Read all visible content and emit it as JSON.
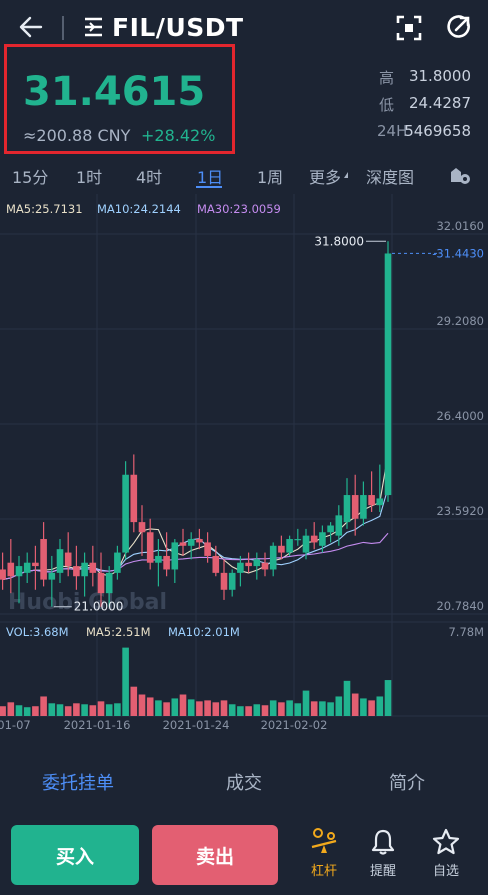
{
  "header": {
    "pair": "FIL/USDT"
  },
  "ticker": {
    "last_price": "31.4615",
    "cny": "≈200.88 CNY",
    "change": "+28.42%",
    "high_label": "高",
    "high": "31.8000",
    "low_label": "低",
    "low": "24.4287",
    "vol_label": "24H",
    "vol": "5469658"
  },
  "tabs": [
    "15分",
    "1时",
    "4时",
    "1日",
    "1周",
    "更多",
    "深度图"
  ],
  "active_tab": "1日",
  "chart_data": {
    "type": "candlestick",
    "interval": "1日",
    "ma_labels": {
      "ma5": "MA5:25.7131",
      "ma10": "MA10:24.2144",
      "ma30": "MA30:23.0059"
    },
    "price_axis": [
      "32.0160",
      "29.2080",
      "26.4000",
      "23.5920",
      "20.7840"
    ],
    "price_range": [
      20.784,
      32.016
    ],
    "current_price_label": "31.4430",
    "max_label": "31.8000",
    "min_label": "21.0000",
    "x_labels": [
      "01-07",
      "2021-01-16",
      "2021-01-24",
      "2021-02-02"
    ],
    "watermark": "Huobi Global",
    "volume_labels": {
      "vol": "VOL:3.68M",
      "ma5": "MA5:2.51M",
      "ma10": "MA10:2.01M",
      "max": "7.78M"
    },
    "colors": {
      "up": "#21b38f",
      "down": "#e35f72",
      "ma5": "#e8e0c8",
      "ma10": "#9fd1ff",
      "ma30": "#c58cf0"
    },
    "candles": [
      {
        "o": 22.1,
        "h": 22.6,
        "l": 21.5,
        "c": 21.8,
        "v": 1.0
      },
      {
        "o": 22.3,
        "h": 23.0,
        "l": 21.4,
        "c": 21.9,
        "v": 1.4
      },
      {
        "o": 21.9,
        "h": 22.5,
        "l": 21.1,
        "c": 22.2,
        "v": 1.1
      },
      {
        "o": 22.0,
        "h": 22.6,
        "l": 21.7,
        "c": 22.3,
        "v": 0.9
      },
      {
        "o": 22.3,
        "h": 22.8,
        "l": 21.5,
        "c": 22.2,
        "v": 1.0
      },
      {
        "o": 23.0,
        "h": 23.5,
        "l": 21.6,
        "c": 21.8,
        "v": 2.0
      },
      {
        "o": 21.8,
        "h": 22.5,
        "l": 21.0,
        "c": 22.0,
        "v": 1.3
      },
      {
        "o": 22.0,
        "h": 23.0,
        "l": 21.7,
        "c": 22.7,
        "v": 1.2
      },
      {
        "o": 22.6,
        "h": 23.2,
        "l": 21.9,
        "c": 22.2,
        "v": 1.0
      },
      {
        "o": 22.2,
        "h": 22.8,
        "l": 21.5,
        "c": 21.9,
        "v": 1.3
      },
      {
        "o": 21.9,
        "h": 22.6,
        "l": 21.3,
        "c": 22.3,
        "v": 1.2
      },
      {
        "o": 22.3,
        "h": 22.8,
        "l": 21.6,
        "c": 22.0,
        "v": 1.1
      },
      {
        "o": 22.0,
        "h": 22.6,
        "l": 21.0,
        "c": 21.4,
        "v": 1.5
      },
      {
        "o": 21.4,
        "h": 22.2,
        "l": 21.0,
        "c": 22.0,
        "v": 1.2
      },
      {
        "o": 22.0,
        "h": 22.8,
        "l": 21.8,
        "c": 22.6,
        "v": 1.3
      },
      {
        "o": 22.6,
        "h": 25.3,
        "l": 22.4,
        "c": 24.9,
        "v": 7.0
      },
      {
        "o": 24.9,
        "h": 25.5,
        "l": 23.2,
        "c": 23.5,
        "v": 3.0
      },
      {
        "o": 23.5,
        "h": 24.0,
        "l": 22.5,
        "c": 23.2,
        "v": 2.2
      },
      {
        "o": 23.2,
        "h": 23.6,
        "l": 22.1,
        "c": 22.3,
        "v": 1.9
      },
      {
        "o": 22.3,
        "h": 23.0,
        "l": 21.6,
        "c": 22.5,
        "v": 1.6
      },
      {
        "o": 22.5,
        "h": 23.2,
        "l": 21.9,
        "c": 22.1,
        "v": 1.4
      },
      {
        "o": 22.1,
        "h": 23.0,
        "l": 21.7,
        "c": 22.9,
        "v": 1.8
      },
      {
        "o": 22.9,
        "h": 23.3,
        "l": 22.5,
        "c": 22.8,
        "v": 2.2
      },
      {
        "o": 22.8,
        "h": 23.2,
        "l": 22.4,
        "c": 23.0,
        "v": 1.7
      },
      {
        "o": 23.0,
        "h": 23.3,
        "l": 22.7,
        "c": 22.9,
        "v": 1.5
      },
      {
        "o": 22.9,
        "h": 23.2,
        "l": 22.3,
        "c": 22.5,
        "v": 1.6
      },
      {
        "o": 22.5,
        "h": 22.8,
        "l": 21.9,
        "c": 22.0,
        "v": 1.4
      },
      {
        "o": 22.0,
        "h": 22.4,
        "l": 21.2,
        "c": 21.5,
        "v": 1.6
      },
      {
        "o": 21.5,
        "h": 22.1,
        "l": 21.3,
        "c": 22.0,
        "v": 1.2
      },
      {
        "o": 22.0,
        "h": 22.5,
        "l": 21.6,
        "c": 22.3,
        "v": 1.0
      },
      {
        "o": 22.3,
        "h": 22.6,
        "l": 22.0,
        "c": 22.2,
        "v": 1.0
      },
      {
        "o": 22.2,
        "h": 22.6,
        "l": 21.8,
        "c": 22.4,
        "v": 1.2
      },
      {
        "o": 22.3,
        "h": 22.6,
        "l": 21.9,
        "c": 22.1,
        "v": 1.1
      },
      {
        "o": 22.1,
        "h": 22.9,
        "l": 21.9,
        "c": 22.8,
        "v": 1.6
      },
      {
        "o": 22.8,
        "h": 23.1,
        "l": 22.4,
        "c": 22.6,
        "v": 1.4
      },
      {
        "o": 22.6,
        "h": 23.1,
        "l": 22.5,
        "c": 23.0,
        "v": 1.6
      },
      {
        "o": 23.0,
        "h": 23.3,
        "l": 22.8,
        "c": 23.0,
        "v": 1.3
      },
      {
        "o": 22.6,
        "h": 23.3,
        "l": 22.4,
        "c": 23.1,
        "v": 2.6
      },
      {
        "o": 23.1,
        "h": 23.5,
        "l": 22.7,
        "c": 22.9,
        "v": 1.5
      },
      {
        "o": 22.8,
        "h": 23.4,
        "l": 22.6,
        "c": 23.2,
        "v": 1.5
      },
      {
        "o": 23.2,
        "h": 23.5,
        "l": 22.9,
        "c": 23.4,
        "v": 1.4
      },
      {
        "o": 23.1,
        "h": 24.0,
        "l": 22.8,
        "c": 23.7,
        "v": 2.0
      },
      {
        "o": 23.5,
        "h": 24.8,
        "l": 23.3,
        "c": 24.3,
        "v": 3.6
      },
      {
        "o": 24.3,
        "h": 24.9,
        "l": 23.1,
        "c": 23.6,
        "v": 2.3
      },
      {
        "o": 23.6,
        "h": 24.7,
        "l": 23.4,
        "c": 24.3,
        "v": 1.8
      },
      {
        "o": 24.3,
        "h": 25.0,
        "l": 23.8,
        "c": 24.0,
        "v": 1.6
      },
      {
        "o": 24.0,
        "h": 25.2,
        "l": 23.8,
        "c": 24.2,
        "v": 2.0
      },
      {
        "o": 24.3,
        "h": 31.8,
        "l": 24.1,
        "c": 31.44,
        "v": 3.68
      }
    ]
  },
  "bottom_tabs": [
    "委托挂单",
    "成交",
    "简介"
  ],
  "footer": {
    "buy": "买入",
    "sell": "卖出",
    "leverage": "杠杆",
    "alert": "提醒",
    "watch": "自选"
  }
}
